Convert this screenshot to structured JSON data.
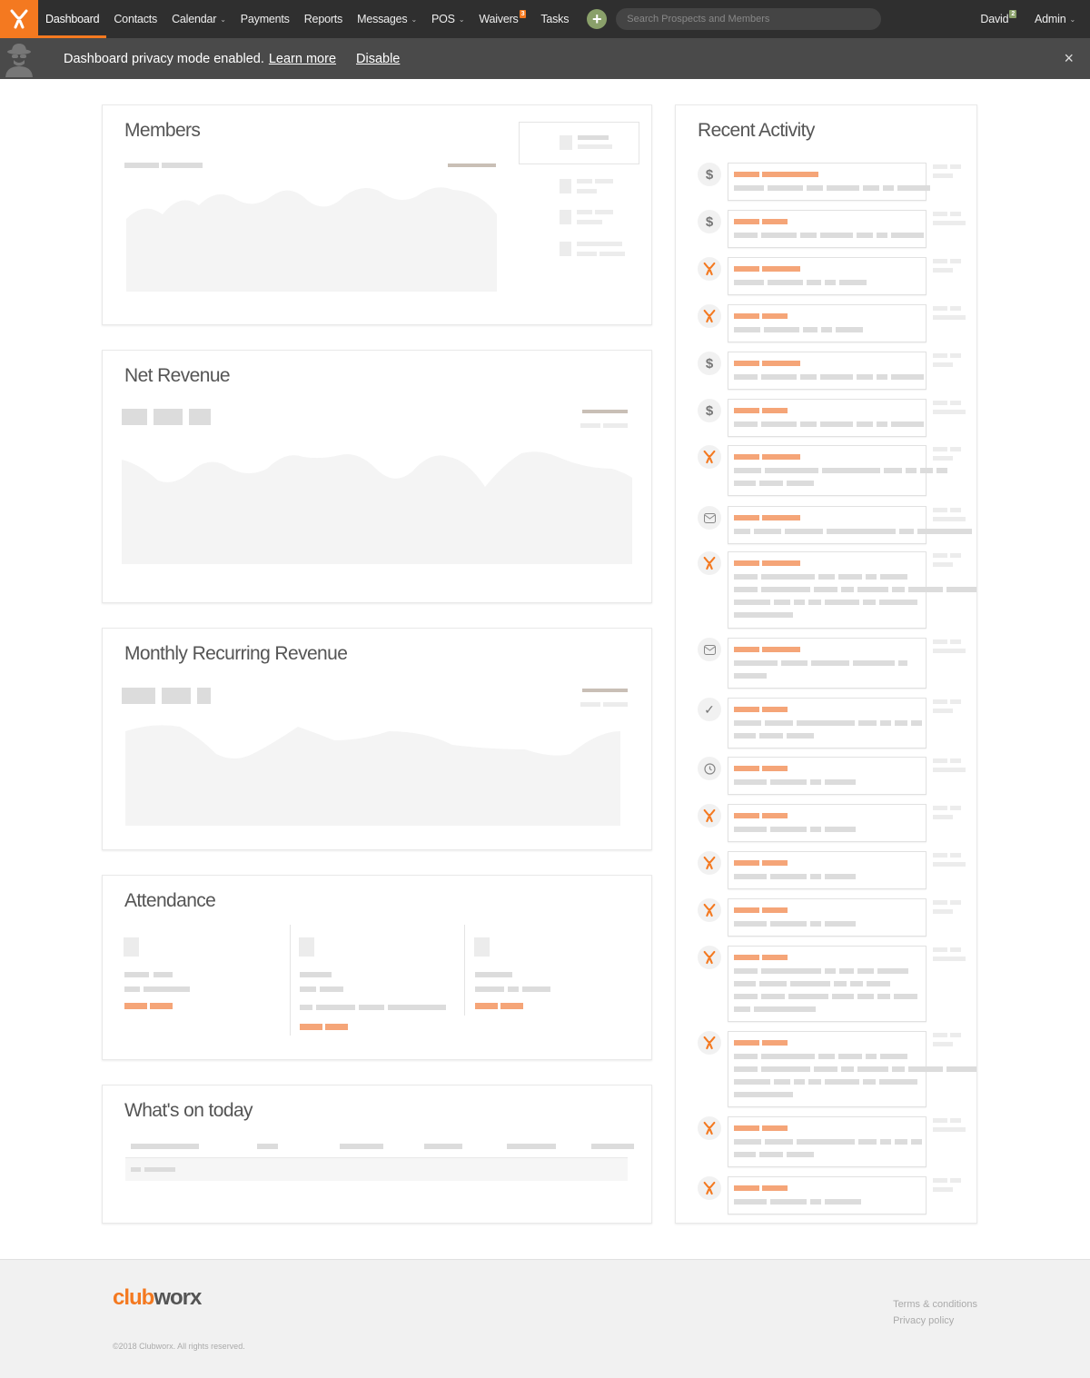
{
  "nav": {
    "items": [
      {
        "label": "Dashboard",
        "chevron": false,
        "badge": ""
      },
      {
        "label": "Contacts",
        "chevron": false,
        "badge": ""
      },
      {
        "label": "Calendar",
        "chevron": true,
        "badge": ""
      },
      {
        "label": "Payments",
        "chevron": false,
        "badge": ""
      },
      {
        "label": "Reports",
        "chevron": false,
        "badge": ""
      },
      {
        "label": "Messages",
        "chevron": true,
        "badge": ""
      },
      {
        "label": "POS",
        "chevron": true,
        "badge": ""
      },
      {
        "label": "Waivers",
        "chevron": false,
        "badge": "3"
      },
      {
        "label": "Tasks",
        "chevron": false,
        "badge": ""
      }
    ],
    "active": "Dashboard",
    "add_label": "+",
    "search_placeholder": "Search Prospects and Members",
    "user": {
      "name": "David",
      "badge": "2"
    },
    "admin": "Admin"
  },
  "privacy": {
    "message": "Dashboard privacy mode enabled.",
    "learn_more": "Learn more",
    "disable": "Disable",
    "close": "×"
  },
  "cards": {
    "members": "Members",
    "net_revenue": "Net Revenue",
    "mrr": "Monthly Recurring Revenue",
    "attendance": "Attendance",
    "whats_on": "What's on today",
    "recent_activity": "Recent Activity"
  },
  "activity_icons": [
    "dollar-icon",
    "dollar-icon",
    "clubworx-icon",
    "clubworx-icon",
    "dollar-icon",
    "dollar-icon",
    "clubworx-icon",
    "envelope-icon",
    "clubworx-icon",
    "envelope-icon",
    "check-icon",
    "clock-icon",
    "clubworx-icon",
    "clubworx-icon",
    "clubworx-icon",
    "clubworx-icon",
    "clubworx-icon",
    "clubworx-icon",
    "clubworx-icon"
  ],
  "footer": {
    "brand_a": "club",
    "brand_b": "worx",
    "terms": "Terms & conditions",
    "privacy": "Privacy policy",
    "copyright": "©2018 Clubworx. All rights reserved."
  },
  "colors": {
    "accent": "#f47920",
    "nav_bg": "#2f2f2f",
    "banner_bg": "#4a4a4a",
    "add_green": "#8aa06a"
  }
}
